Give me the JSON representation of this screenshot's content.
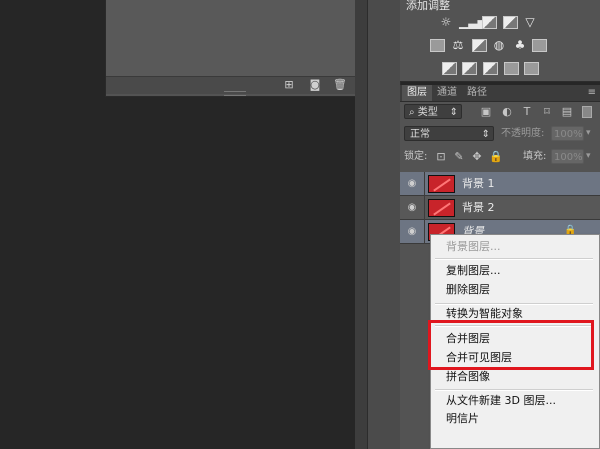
{
  "adjustments": {
    "title": "添加调整",
    "icons_row1": [
      "brightness-contrast-icon",
      "levels-icon",
      "curves-icon",
      "exposure-icon",
      "vibrance-icon"
    ],
    "icons_row2": [
      "hue-saturation-icon",
      "color-balance-icon",
      "black-white-icon",
      "photo-filter-icon",
      "channel-mixer-icon",
      "color-lookup-icon"
    ],
    "icons_row3": [
      "invert-icon",
      "posterize-icon",
      "threshold-icon",
      "selective-color-icon",
      "gradient-map-icon"
    ]
  },
  "layers_panel": {
    "tabs": [
      {
        "label": "图层",
        "active": true
      },
      {
        "label": "通道",
        "active": false
      },
      {
        "label": "路径",
        "active": false
      }
    ],
    "filter_kind": "类型",
    "blend_mode": "正常",
    "opacity_label": "不透明度:",
    "opacity_value": "100%",
    "lock_label": "锁定:",
    "fill_label": "填充:",
    "fill_value": "100%",
    "layers": [
      {
        "name": "背景 1",
        "selected": true
      },
      {
        "name": "背景 2",
        "selected": false
      },
      {
        "name": "背景",
        "selected": true,
        "locked": true
      }
    ]
  },
  "context_menu": {
    "items": [
      {
        "label": "背景图层...",
        "disabled": true
      },
      {
        "label": "复制图层...",
        "disabled": false
      },
      {
        "label": "删除图层",
        "disabled": false
      },
      {
        "label": "转换为智能对象",
        "disabled": false
      },
      {
        "label": "合并图层",
        "disabled": false
      },
      {
        "label": "合并可见图层",
        "disabled": false
      },
      {
        "label": "拼合图像",
        "disabled": false
      },
      {
        "label": "从文件新建 3D 图层...",
        "disabled": false
      },
      {
        "label": "明信片",
        "disabled": false
      }
    ]
  },
  "colors": {
    "canvas_bg": "#262626",
    "panel_bg": "#535353",
    "selected_row": "#6d7583",
    "highlight_box": "#e0161e"
  }
}
